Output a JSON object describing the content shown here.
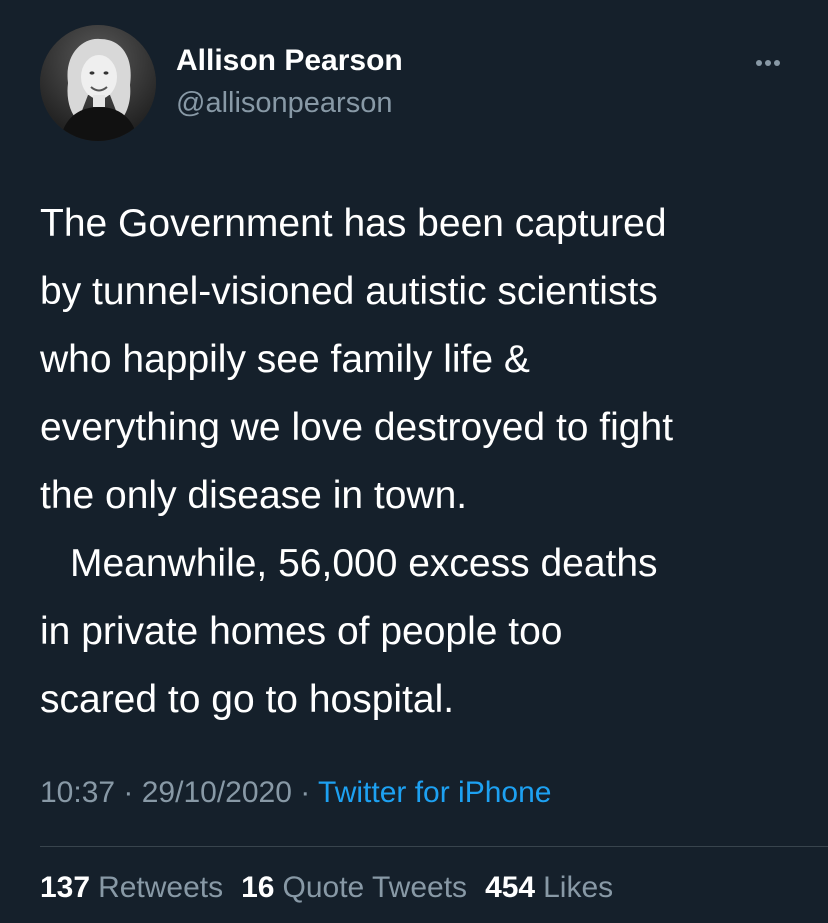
{
  "author": {
    "name": "Allison Pearson",
    "handle": "@allisonpearson",
    "avatar_icon": "profile-photo"
  },
  "more_icon": "more-horizontal-icon",
  "tweet": {
    "lines": [
      "The Government has been captured",
      "by tunnel-visioned autistic scientists",
      "who happily see family life &",
      "everything we love destroyed to fight",
      "the only disease in town.",
      "Meanwhile, 56,000 excess deaths",
      "in private homes of people too",
      "scared to go to hospital."
    ]
  },
  "meta": {
    "time": "10:37",
    "separator": " · ",
    "date": "29/10/2020",
    "source": "Twitter for iPhone"
  },
  "stats": {
    "retweets": {
      "count": "137",
      "label": "Retweets"
    },
    "quote_tweets": {
      "count": "16",
      "label": "Quote Tweets"
    },
    "likes": {
      "count": "454",
      "label": "Likes"
    }
  },
  "colors": {
    "background": "#15202b",
    "text": "#ffffff",
    "secondary": "#8899a6",
    "link": "#1da1f2",
    "divider": "#38444d"
  }
}
